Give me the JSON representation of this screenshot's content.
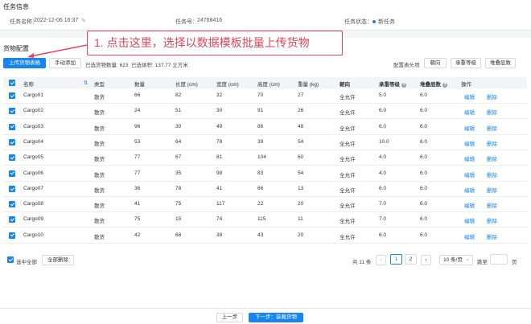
{
  "task_info": {
    "section_title": "任务信息",
    "name_label": "任务名称：",
    "name_value": "2022-12-06 16:37",
    "number_label": "任务号：",
    "number_value": "24768416",
    "status_label": "任务状态：",
    "status_value": "新任务"
  },
  "cargo": {
    "section_title": "货物配置",
    "upload_template_button": "上传货物表格",
    "manual_add_button": "手动添加",
    "selected_count_label": "已选货物数量: 623",
    "selected_volume_label": "已选体积: 137.77 立方米",
    "config_header_label": "配置表头项",
    "filter_buttons": [
      "朝向",
      "承重等级",
      "堆叠层数"
    ]
  },
  "callout_text": "1. 点击这里，选择以数据模板批量上传货物",
  "table": {
    "headers": {
      "name": "名称",
      "type": "类型",
      "qty": "数量",
      "length": "长度 (cm)",
      "width": "宽度 (cm)",
      "height": "高度 (cm)",
      "weight": "重量 (kg)",
      "orient": "朝向",
      "load": "承重等级",
      "stack": "堆叠层数",
      "actions": "操作"
    },
    "edit_label": "编辑",
    "delete_label": "删除",
    "rows": [
      [
        "Cargo01",
        "散货",
        "66",
        "82",
        "32",
        "70",
        "27",
        "全允许",
        "5.0",
        "6.0"
      ],
      [
        "Cargo02",
        "散货",
        "24",
        "51",
        "30",
        "91",
        "26",
        "全允许",
        "6.0",
        "6.0"
      ],
      [
        "Cargo03",
        "散货",
        "96",
        "30",
        "49",
        "86",
        "48",
        "全允许",
        "6.0",
        "6.0"
      ],
      [
        "Cargo04",
        "散货",
        "53",
        "64",
        "78",
        "39",
        "54",
        "全允许",
        "10.0",
        "6.0"
      ],
      [
        "Cargo05",
        "散货",
        "77",
        "67",
        "81",
        "104",
        "60",
        "全允许",
        "4.0",
        "6.0"
      ],
      [
        "Cargo06",
        "散货",
        "77",
        "35",
        "98",
        "83",
        "54",
        "全允许",
        "4.0",
        "6.0"
      ],
      [
        "Cargo07",
        "散货",
        "36",
        "78",
        "41",
        "66",
        "13",
        "全允许",
        "6.0",
        "6.0"
      ],
      [
        "Cargo08",
        "散货",
        "41",
        "75",
        "117",
        "22",
        "20",
        "全允许",
        "7.0",
        "6.0"
      ],
      [
        "Cargo09",
        "散货",
        "75",
        "15",
        "74",
        "115",
        "11",
        "全允许",
        "7.0",
        "6.0"
      ],
      [
        "Cargo10",
        "散货",
        "42",
        "68",
        "38",
        "43",
        "20",
        "全允许",
        "6.0",
        "6.0"
      ]
    ]
  },
  "bulk": {
    "select_all_label": "选中全部",
    "delete_all_button": "全部删除"
  },
  "pagination": {
    "total_label": "共 11 条",
    "prev_icon": "‹",
    "pages": [
      "1",
      "2"
    ],
    "next_icon": "›",
    "page_size": "10 条/页",
    "page_size_chevron": "⌄",
    "jump_label": "跳至",
    "jump_value": "",
    "page_suffix": "页"
  },
  "footer": {
    "prev_button": "上一步",
    "next_button": "下一步：装载货物"
  },
  "colors": {
    "primary": "#1684f1",
    "callout": "#e8445a",
    "status_dot": "#1684f1"
  }
}
